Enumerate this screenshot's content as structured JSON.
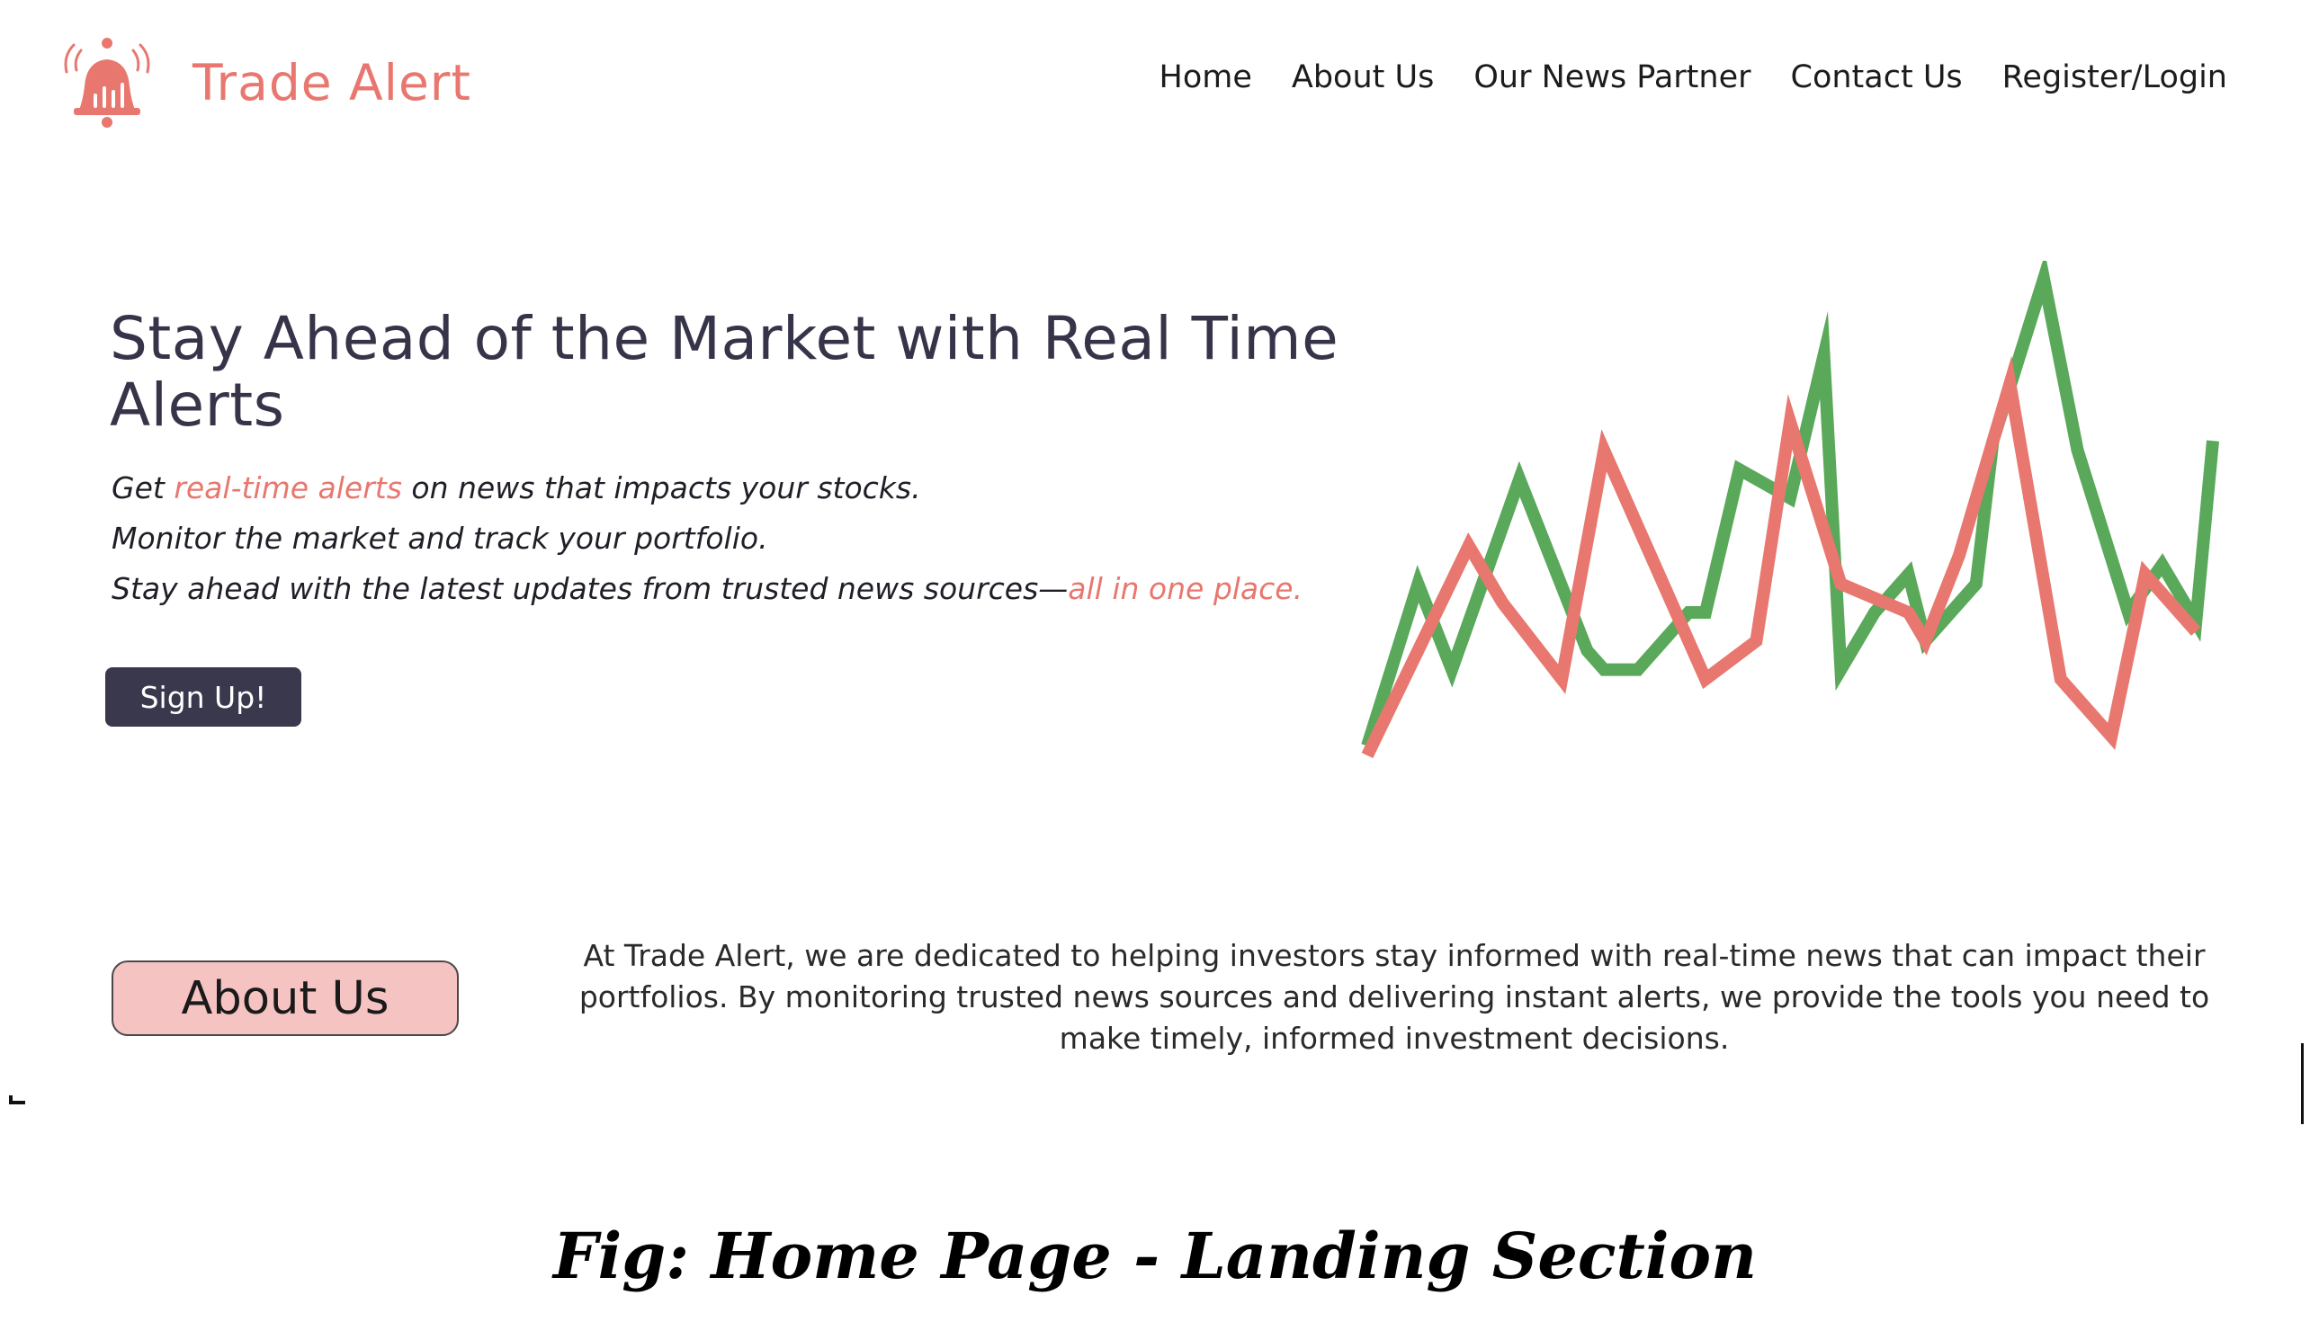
{
  "header": {
    "logo_text": "Trade Alert",
    "logo_icon": "bell-alert-icon",
    "nav": [
      {
        "label": "Home"
      },
      {
        "label": "About Us"
      },
      {
        "label": "Our News Partner"
      },
      {
        "label": "Contact Us"
      },
      {
        "label": "Register/Login"
      }
    ]
  },
  "hero": {
    "title": "Stay Ahead of the Market with Real Time Alerts",
    "line1_before": "Get ",
    "line1_highlight": "real-time alerts",
    "line1_after": " on news that impacts your stocks.",
    "line2": "Monitor the market and track your portfolio.",
    "line3_before": "Stay ahead with the latest updates from trusted news sources—",
    "line3_highlight": "all in one place.",
    "signup_label": "Sign Up!"
  },
  "chart_data": {
    "type": "line",
    "title": "",
    "xlabel": "",
    "ylabel": "",
    "ylim": [
      0,
      100
    ],
    "grid": false,
    "legend": "none",
    "series": [
      {
        "color": "#5aa85a",
        "x": [
          0,
          6,
          10,
          18,
          26,
          28,
          32,
          38,
          40,
          44,
          50,
          54,
          56,
          60,
          64,
          66,
          72,
          74,
          80,
          84,
          90,
          94,
          98,
          100
        ],
        "values": [
          2,
          36,
          18,
          58,
          22,
          18,
          18,
          30,
          30,
          60,
          54,
          84,
          18,
          30,
          38,
          24,
          36,
          66,
          100,
          64,
          30,
          40,
          28,
          66
        ]
      },
      {
        "color": "#e8776f",
        "x": [
          0,
          6,
          12,
          16,
          23,
          28,
          34,
          40,
          46,
          50,
          56,
          64,
          66,
          70,
          76,
          82,
          88,
          92,
          98
        ],
        "values": [
          0,
          22,
          44,
          32,
          16,
          64,
          40,
          16,
          24,
          70,
          36,
          30,
          24,
          42,
          78,
          16,
          4,
          38,
          26
        ]
      }
    ]
  },
  "about": {
    "button_label": "About Us",
    "text": "At Trade Alert, we are dedicated to helping investors stay informed with real-time news that can impact their portfolios. By monitoring trusted news sources and delivering instant alerts, we provide the tools you need to make timely, informed investment decisions."
  },
  "caption": "Fig: Home Page - Landing Section"
}
